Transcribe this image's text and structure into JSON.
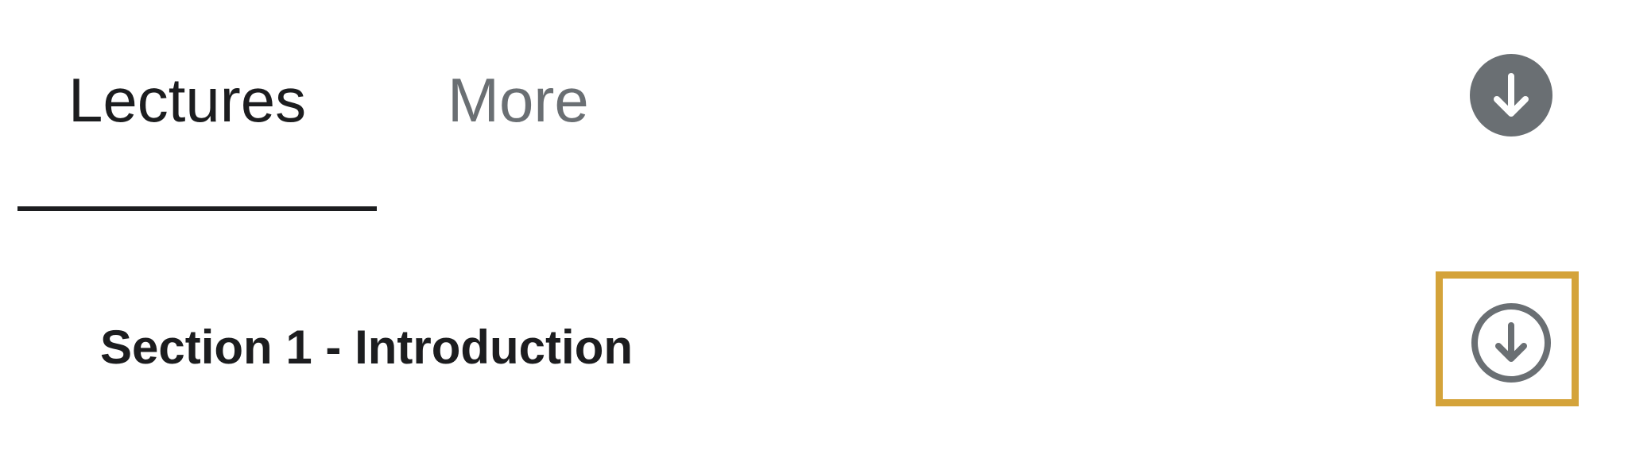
{
  "tabs": {
    "lectures": {
      "label": "Lectures",
      "active": true
    },
    "more": {
      "label": "More",
      "active": false
    }
  },
  "header": {
    "download_all_icon": "download-arrow-filled-circle-icon"
  },
  "section": {
    "title": "Section 1 - Introduction",
    "download_icon": "download-arrow-outline-circle-icon"
  },
  "colors": {
    "active_text": "#1c1d1f",
    "inactive_text": "#6a6f73",
    "icon_gray": "#6a6f73",
    "highlight": "#d4a33a"
  }
}
